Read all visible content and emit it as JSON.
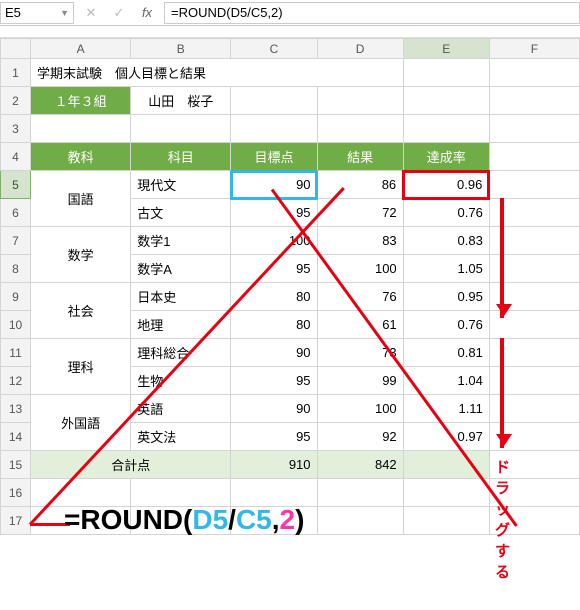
{
  "formula_bar": {
    "namebox": "E5",
    "formula": "=ROUND(D5/C5,2)"
  },
  "columns": [
    "A",
    "B",
    "C",
    "D",
    "E",
    "F"
  ],
  "rows": [
    "1",
    "2",
    "3",
    "4",
    "5",
    "6",
    "7",
    "8",
    "9",
    "10",
    "11",
    "12",
    "13",
    "14",
    "15",
    "16",
    "17"
  ],
  "title": "学期末試験　個人目標と結果",
  "class_label": "１年３組",
  "student": "山田　桜子",
  "headers": {
    "a": "教科",
    "b": "科目",
    "c": "目標点",
    "d": "結果",
    "e": "達成率"
  },
  "subjects": [
    {
      "group": "国語",
      "name": "現代文",
      "target": "90",
      "result": "86",
      "rate": "0.96"
    },
    {
      "group": "",
      "name": "古文",
      "target": "95",
      "result": "72",
      "rate": "0.76"
    },
    {
      "group": "数学",
      "name": "数学1",
      "target": "100",
      "result": "83",
      "rate": "0.83"
    },
    {
      "group": "",
      "name": "数学A",
      "target": "95",
      "result": "100",
      "rate": "1.05"
    },
    {
      "group": "社会",
      "name": "日本史",
      "target": "80",
      "result": "76",
      "rate": "0.95"
    },
    {
      "group": "",
      "name": "地理",
      "target": "80",
      "result": "61",
      "rate": "0.76"
    },
    {
      "group": "理科",
      "name": "理科総合",
      "target": "90",
      "result": "73",
      "rate": "0.81"
    },
    {
      "group": "",
      "name": "生物",
      "target": "95",
      "result": "99",
      "rate": "1.04"
    },
    {
      "group": "外国語",
      "name": "英語",
      "target": "90",
      "result": "100",
      "rate": "1.11"
    },
    {
      "group": "",
      "name": "英文法",
      "target": "95",
      "result": "92",
      "rate": "0.97"
    }
  ],
  "totals": {
    "label": "合計点",
    "target": "910",
    "result": "842"
  },
  "annotation": {
    "drag": "ドラッグする"
  },
  "big_formula": {
    "eq": "=",
    "fn": "ROUND",
    "open": "(",
    "d5": "D5",
    "slash": "/",
    "c5": "C5",
    "comma": ",",
    "digits": "2",
    "close": ")"
  },
  "chart_data": {
    "type": "table",
    "title": "学期末試験　個人目標と結果 — 1年3組 山田 桜子",
    "columns": [
      "教科",
      "科目",
      "目標点",
      "結果",
      "達成率"
    ],
    "rows": [
      [
        "国語",
        "現代文",
        90,
        86,
        0.96
      ],
      [
        "国語",
        "古文",
        95,
        72,
        0.76
      ],
      [
        "数学",
        "数学1",
        100,
        83,
        0.83
      ],
      [
        "数学",
        "数学A",
        95,
        100,
        1.05
      ],
      [
        "社会",
        "日本史",
        80,
        76,
        0.95
      ],
      [
        "社会",
        "地理",
        80,
        61,
        0.76
      ],
      [
        "理科",
        "理科総合",
        90,
        73,
        0.81
      ],
      [
        "理科",
        "生物",
        95,
        99,
        1.04
      ],
      [
        "外国語",
        "英語",
        90,
        100,
        1.11
      ],
      [
        "外国語",
        "英文法",
        95,
        92,
        0.97
      ]
    ],
    "totals": {
      "目標点": 910,
      "結果": 842
    }
  }
}
